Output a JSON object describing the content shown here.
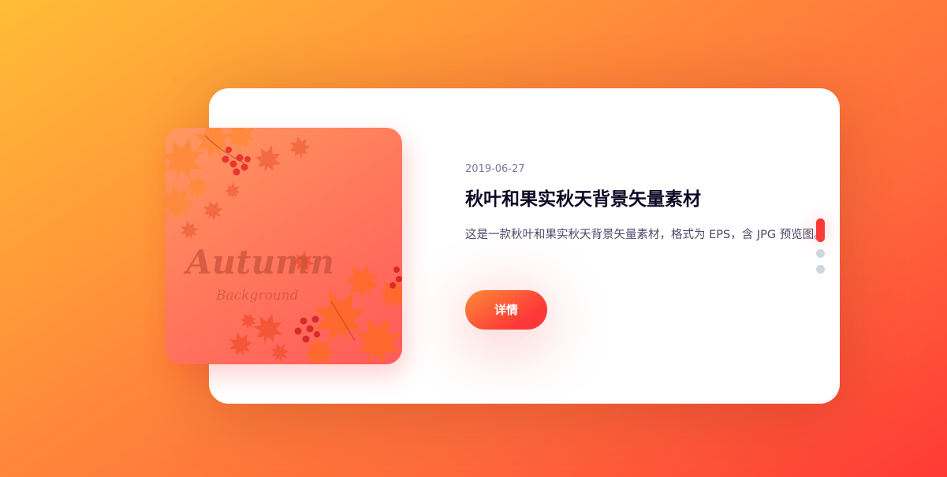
{
  "slide": {
    "image": {
      "art_title": "Autumn",
      "art_subtitle": "Background"
    },
    "date": "2019-06-27",
    "title": "秋叶和果实秋天背景矢量素材",
    "description": "这是一款秋叶和果实秋天背景矢量素材，格式为 EPS，含 JPG 预览图。",
    "button_label": "详情"
  },
  "pagination": {
    "count": 3,
    "active_index": 0
  },
  "colors": {
    "accent": "#fd3838",
    "accent_start": "#fe8a39",
    "title": "#0d0925",
    "text": "#4e4a67",
    "date": "#7b7992",
    "dot_inactive": "#cfd6de"
  },
  "icons": {
    "leaf": "maple-leaf-icon",
    "berries": "berry-cluster-icon"
  }
}
